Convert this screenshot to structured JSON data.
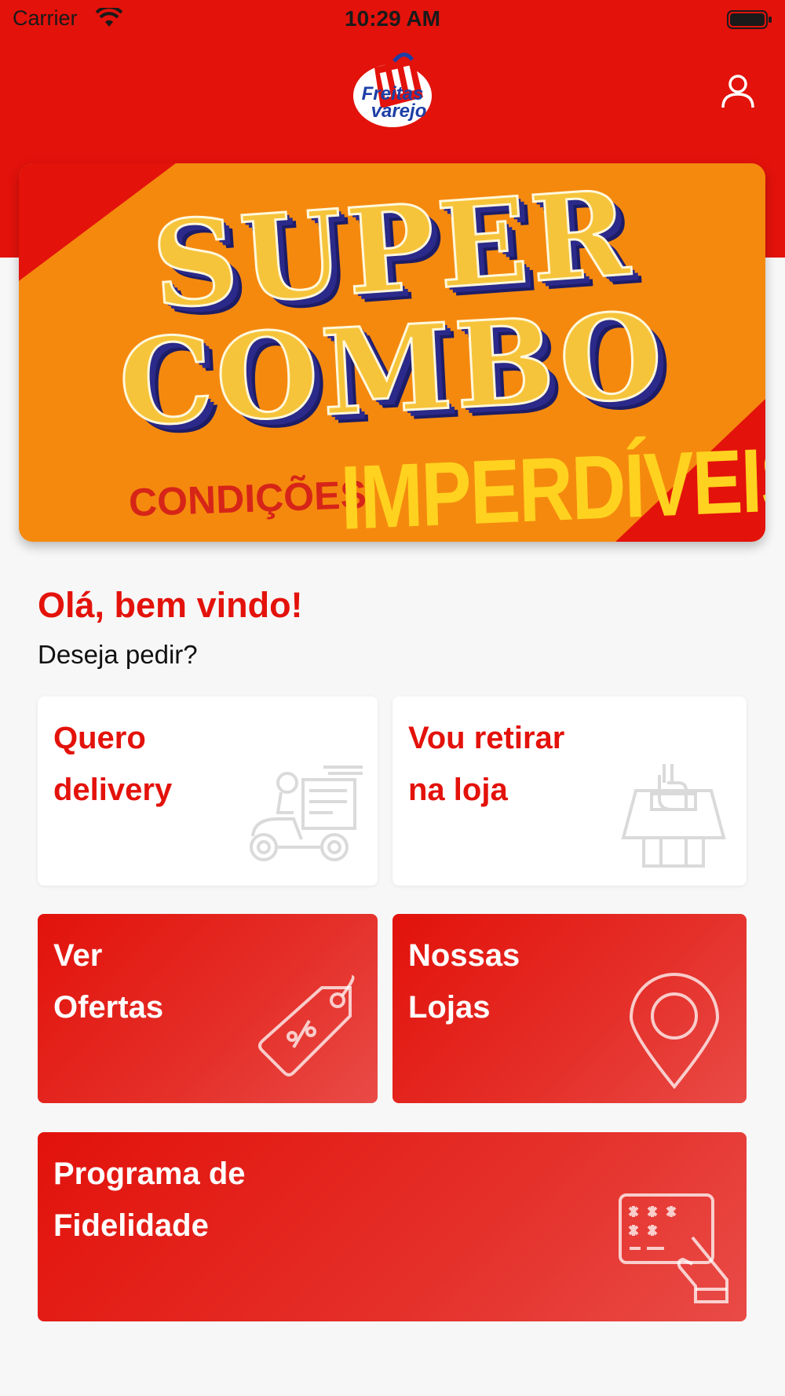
{
  "status_bar": {
    "carrier": "Carrier",
    "time": "10:29 AM"
  },
  "header": {
    "logo_line1": "Freitas",
    "logo_line2": "varejo",
    "brand_color": "#e3120b",
    "profile_icon": "user-icon"
  },
  "banner": {
    "line1": "SUPER",
    "line2": "COMBO",
    "line3a": "CONDIÇÕES",
    "line3b": "IMPERDÍVEIS"
  },
  "welcome": {
    "title": "Olá, bem vindo!",
    "subtitle": "Deseja pedir?"
  },
  "cards": {
    "delivery": {
      "label": "Quero\ndelivery",
      "icon": "delivery-scooter-icon"
    },
    "pickup": {
      "label": "Vou retirar\nna loja",
      "icon": "store-pickup-icon"
    },
    "offers": {
      "label": "Ver\nOfertas",
      "icon": "discount-tag-icon"
    },
    "stores": {
      "label": "Nossas\nLojas",
      "icon": "location-pin-icon"
    },
    "loyalty": {
      "label": "Programa de\nFidelidade",
      "icon": "loyalty-card-icon"
    }
  }
}
